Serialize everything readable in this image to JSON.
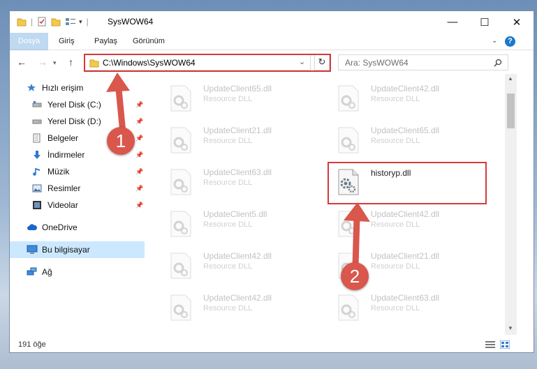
{
  "window": {
    "title": "SysWOW64",
    "controls": {
      "minimize": "—",
      "maximize": "☐",
      "close": "✕"
    }
  },
  "ribbon": {
    "tabs": [
      "Dosya",
      "Giriş",
      "Paylaş",
      "Görünüm"
    ],
    "help": "?"
  },
  "address_bar": {
    "path": "C:\\Windows\\SysWOW64"
  },
  "search": {
    "placeholder": "Ara: SysWOW64"
  },
  "sidebar": {
    "items": [
      {
        "label": "Hızlı erişim",
        "icon": "star-icon"
      },
      {
        "label": "Yerel Disk (C:)",
        "icon": "drive-icon"
      },
      {
        "label": "Yerel Disk (D:)",
        "icon": "drive-icon"
      },
      {
        "label": "Belgeler",
        "icon": "documents-icon"
      },
      {
        "label": "İndirmeler",
        "icon": "download-icon"
      },
      {
        "label": "Müzik",
        "icon": "music-icon"
      },
      {
        "label": "Resimler",
        "icon": "pictures-icon"
      },
      {
        "label": "Videolar",
        "icon": "video-icon"
      },
      {
        "label": "OneDrive",
        "icon": "cloud-icon"
      },
      {
        "label": "Bu bilgisayar",
        "icon": "computer-icon"
      },
      {
        "label": "Ağ",
        "icon": "network-icon"
      }
    ]
  },
  "files": [
    {
      "name": "UpdateClient65.dll",
      "type": "Resource DLL"
    },
    {
      "name": "UpdateClient42.dll",
      "type": "Resource DLL"
    },
    {
      "name": "UpdateClient21.dll",
      "type": "Resource DLL"
    },
    {
      "name": "UpdateClient65.dll",
      "type": "Resource DLL"
    },
    {
      "name": "UpdateClient63.dll",
      "type": "Resource DLL"
    },
    {
      "name": "historyp.dll",
      "type": ""
    },
    {
      "name": "UpdateClient5.dll",
      "type": "Resource DLL"
    },
    {
      "name": "UpdateClient42.dll",
      "type": "Resource DLL"
    },
    {
      "name": "UpdateClient42.dll",
      "type": "Resource DLL"
    },
    {
      "name": "UpdateClient21.dll",
      "type": "Resource DLL"
    },
    {
      "name": "UpdateClient42.dll",
      "type": "Resource DLL"
    },
    {
      "name": "UpdateClient63.dll",
      "type": "Resource DLL"
    }
  ],
  "status": {
    "count": "191 öğe"
  },
  "annotations": {
    "step1": "1",
    "step2": "2"
  },
  "colors": {
    "accent": "#1979ca",
    "highlight": "#d43a3a",
    "badge": "#d9574c",
    "selection": "#cce8ff"
  }
}
